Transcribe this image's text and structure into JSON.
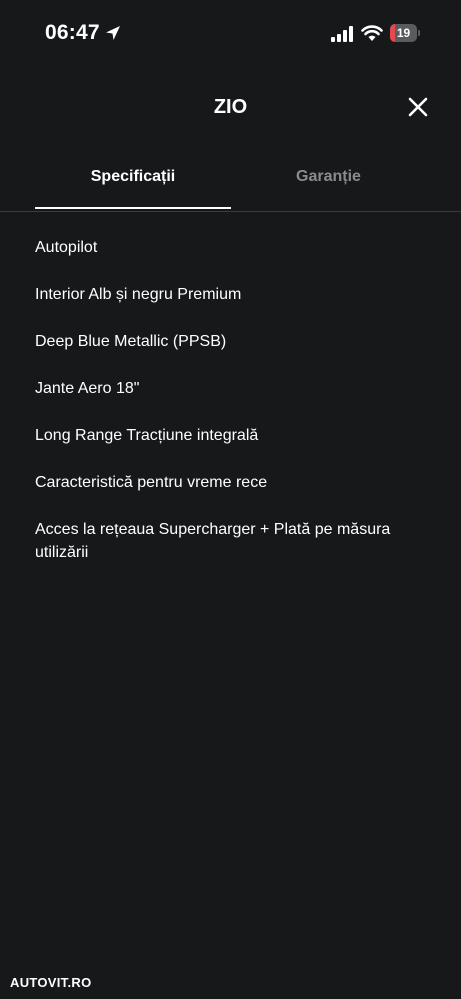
{
  "status_bar": {
    "time": "06:47",
    "battery_level": "19",
    "battery_fraction": 0.19,
    "icons": [
      "location-arrow-icon",
      "cellular-signal-icon",
      "wifi-icon",
      "battery-icon"
    ]
  },
  "header": {
    "title": "ZIO",
    "close_icon": "close-icon"
  },
  "tabs": [
    {
      "label": "Specificații",
      "active": true
    },
    {
      "label": "Garanție",
      "active": false
    }
  ],
  "specs": [
    "Autopilot",
    "Interior Alb și negru Premium",
    "Deep Blue Metallic (PPSB)",
    "Jante Aero 18\"",
    "Long Range Tracțiune integrală",
    "Caracteristică pentru vreme rece",
    "Acces la rețeaua Supercharger + Plată pe măsura utilizării"
  ],
  "watermark": "AUTOVIT.RO",
  "colors": {
    "background": "#17181a",
    "text": "#ffffff",
    "inactive_tab": "#8a8b8f",
    "divider": "#3a3b3e",
    "battery_low": "#e5484d"
  }
}
